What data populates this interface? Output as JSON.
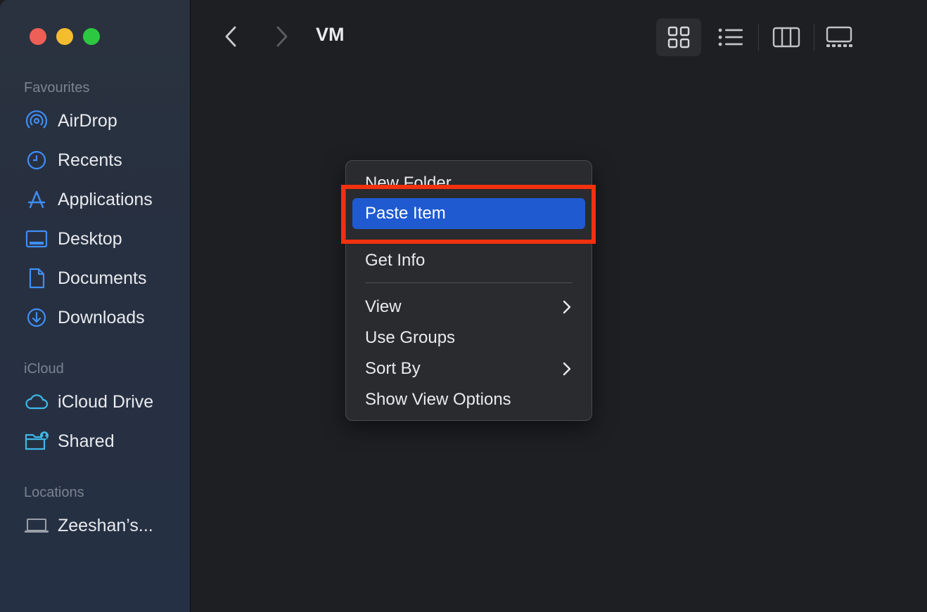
{
  "window": {
    "title": "VM"
  },
  "sidebar": {
    "sections": [
      {
        "label": "Favourites",
        "items": [
          {
            "label": "AirDrop",
            "icon": "airdrop-icon"
          },
          {
            "label": "Recents",
            "icon": "clock-icon"
          },
          {
            "label": "Applications",
            "icon": "applications-icon"
          },
          {
            "label": "Desktop",
            "icon": "desktop-icon"
          },
          {
            "label": "Documents",
            "icon": "document-icon"
          },
          {
            "label": "Downloads",
            "icon": "download-icon"
          }
        ]
      },
      {
        "label": "iCloud",
        "items": [
          {
            "label": "iCloud Drive",
            "icon": "cloud-icon"
          },
          {
            "label": "Shared",
            "icon": "shared-folder-icon"
          }
        ]
      },
      {
        "label": "Locations",
        "items": [
          {
            "label": "Zeeshan’s...",
            "icon": "laptop-icon"
          }
        ]
      }
    ]
  },
  "toolbar": {
    "views": [
      "icon-view",
      "list-view",
      "column-view",
      "gallery-view"
    ],
    "active_view": "icon-view"
  },
  "context_menu": {
    "items": [
      {
        "label": "New Folder"
      },
      {
        "label": "Paste Item",
        "selected": true
      },
      {
        "label": "Get Info"
      },
      {
        "label": "View",
        "submenu": true
      },
      {
        "label": "Use Groups"
      },
      {
        "label": "Sort By",
        "submenu": true
      },
      {
        "label": "Show View Options"
      }
    ]
  },
  "colors": {
    "sidebar_icon": "#3f8ef7",
    "selection": "#1f5ad1",
    "highlight_box": "#f1310f"
  }
}
